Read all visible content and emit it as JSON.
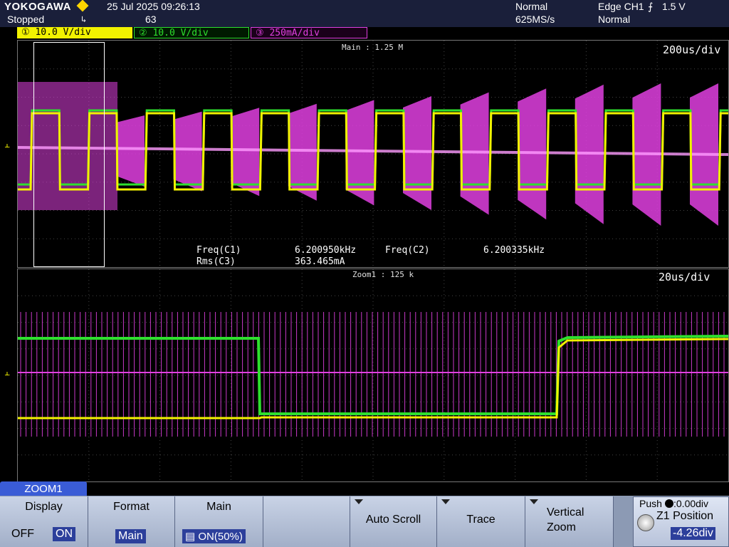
{
  "status": {
    "brand": "YOKOGAWA",
    "run_state": "Stopped",
    "date_time": "25 Jul 2025 09:26:13",
    "acq_count": "63",
    "acq_mode": "Normal",
    "sample_rate": "625MS/s",
    "trigger_source": "Edge CH1",
    "trigger_level": "1.5 V",
    "trigger_mode": "Normal"
  },
  "channels": [
    {
      "num": "1",
      "scale": "10.0 V/div",
      "color": "#f2f200"
    },
    {
      "num": "2",
      "scale": "10.0 V/div",
      "color": "#2ee02e"
    },
    {
      "num": "3",
      "scale": "250mA/div",
      "color": "#e040e0"
    }
  ],
  "main_screen": {
    "record_label": "Main : 1.25 M",
    "timebase": "200us/div",
    "measurements": [
      {
        "name": "Freq(C1)",
        "value": "6.200950kHz"
      },
      {
        "name": "Freq(C2)",
        "value": "6.200335kHz"
      },
      {
        "name": "Rms(C3)",
        "value": "363.465mA"
      }
    ]
  },
  "zoom_screen": {
    "record_label": "Zoom1 : 125 k",
    "timebase": "20us/div"
  },
  "menu": {
    "tab": "ZOOM1",
    "display": {
      "title": "Display",
      "off": "OFF",
      "on": "ON"
    },
    "format": {
      "title": "Format",
      "value": "Main"
    },
    "main": {
      "title": "Main",
      "value": "ON(50%)"
    },
    "auto_scroll": "Auto Scroll",
    "trace": "Trace",
    "vertical_zoom_1": "Vertical",
    "vertical_zoom_2": "Zoom",
    "knob": {
      "push_label": "Push",
      "push_value": ":0.00div",
      "param": "Z1 Position",
      "value": "-4.26div"
    }
  },
  "colors": {
    "ch1": "#f2f200",
    "ch2": "#2ee02e",
    "ch3": "#e040e0",
    "grid": "#555555"
  }
}
